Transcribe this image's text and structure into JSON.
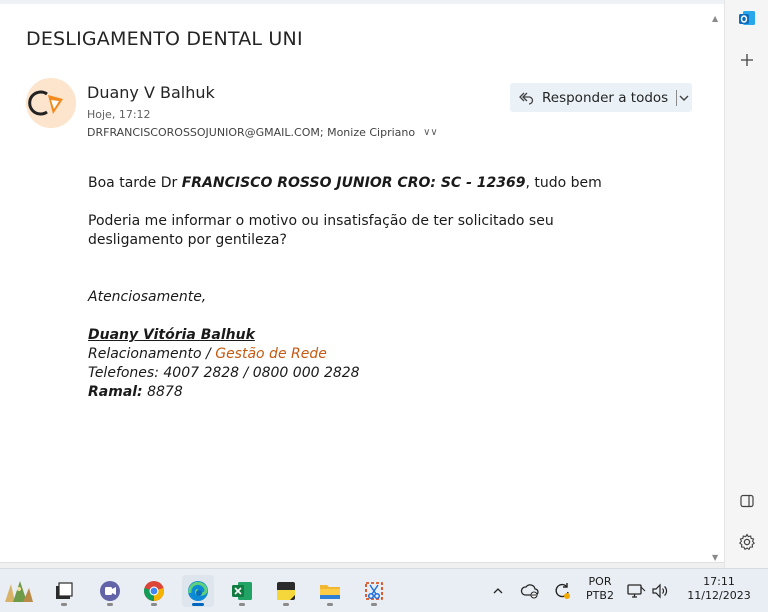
{
  "email": {
    "subject": "DESLIGAMENTO DENTAL UNI",
    "sender_name": "Duany V Balhuk",
    "sent_time": "Hoje, 17:12",
    "recipients": "DRFRANCISCOROSSOJUNIOR@GMAIL.COM; Monize Cipriano",
    "reply_all_label": "Responder a todos"
  },
  "body": {
    "greeting_prefix": "Boa tarde Dr ",
    "greeting_bold": "FRANCISCO ROSSO JUNIOR CRO: SC - 12369",
    "greeting_suffix": ", tudo bem",
    "question": "Poderia me informar o motivo ou insatisfação de ter solicitado seu desligamento por gentileza?",
    "closing": "Atenciosamente,",
    "signature": {
      "name": "Duany Vitória Balhuk ",
      "role_prefix": "Relacionamento / ",
      "role_accent": "Gestão de Rede",
      "phones": "Telefones: 4007 2828 / 0800 000 2828",
      "ramal_label": "Ramal:",
      "ramal_value": " 8878"
    }
  },
  "colors": {
    "accent_orange": "#c55a11",
    "reply_bg": "#eaf2f8",
    "outlook_blue": "#0f6cbd"
  },
  "taskbar": {
    "lang_top": "POR",
    "lang_bottom": "PTB2",
    "time": "17:11",
    "date": "11/12/2023",
    "apps": [
      "widgets-icon",
      "file-manager-icon",
      "teams-icon",
      "chrome-icon",
      "edge-icon",
      "excel-icon",
      "sticky-notes-icon",
      "folder-icon",
      "snipping-tool-icon"
    ]
  }
}
